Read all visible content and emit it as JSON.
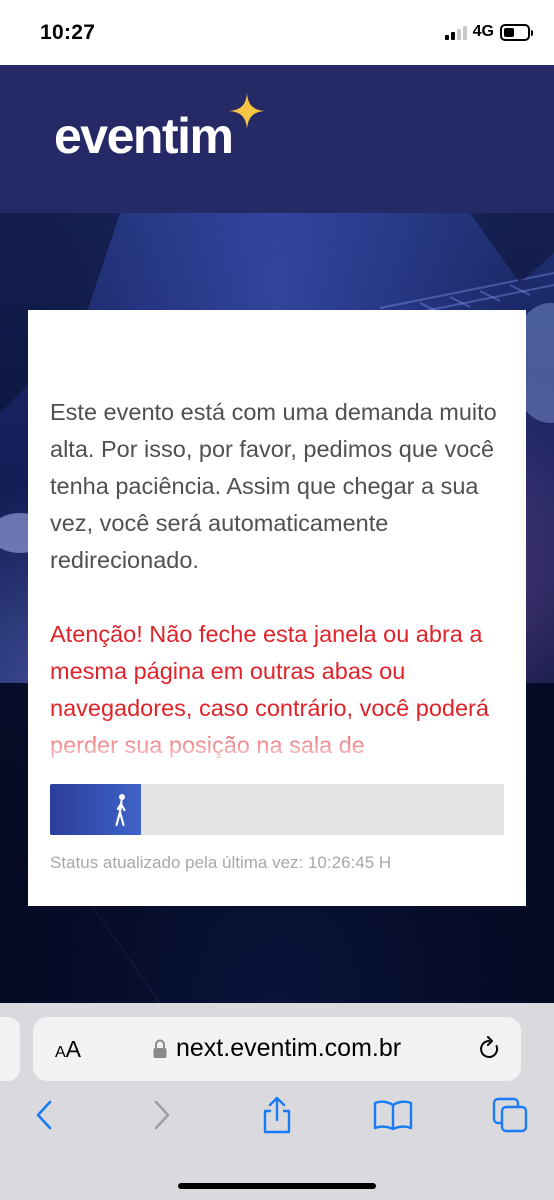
{
  "status_bar": {
    "time": "10:27",
    "network": "4G",
    "signal_bars": 2,
    "signal_bars_total": 4,
    "battery_fraction": 0.45
  },
  "header": {
    "logo_text": "eventim",
    "logo_icon": "sparkle-star-icon",
    "background_color": "#252a66",
    "accent_color": "#f5c644"
  },
  "queue": {
    "info_text": "Este evento está com uma demanda muito alta. Por isso, por favor, pedimos que você tenha paciência. Assim que chegar a sua vez, você será automaticamente redirecionado.",
    "warning_text": "Atenção! Não feche esta janela ou abra a mesma página em outras abas ou navegadores, caso contrário, você poderá perder sua posição na sala de",
    "warning_color": "#e0232a",
    "progress_fraction": 0.2,
    "progress_icon": "walking-person-icon",
    "status_text": "Status atualizado pela última vez: 10:26:45 H"
  },
  "browser": {
    "aa_small": "A",
    "aa_large": "A",
    "url": "next.eventim.com.br",
    "icons": {
      "lock": "lock-icon",
      "reload": "reload-icon",
      "back": "back-chevron-icon",
      "forward": "forward-chevron-icon",
      "share": "share-icon",
      "bookmarks": "book-icon",
      "tabs": "tabs-icon"
    }
  }
}
